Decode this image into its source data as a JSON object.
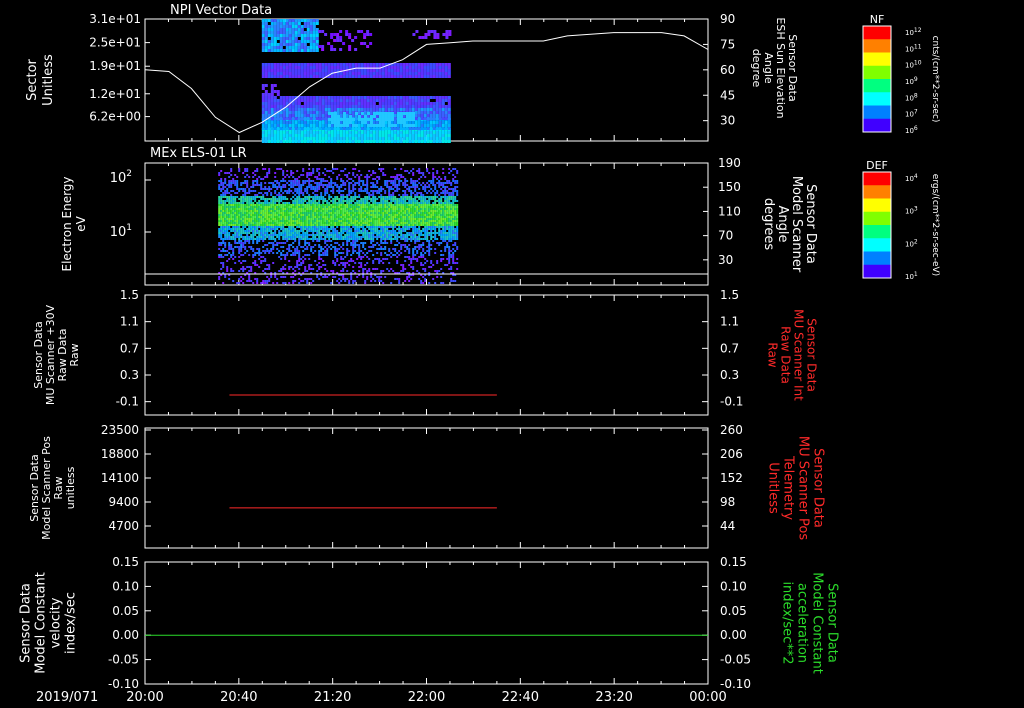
{
  "chart_data": [
    {
      "type": "heatmap",
      "title": "NPI Vector Data",
      "ylabel_left": "Sector\nUnitless",
      "yticks_left": [
        "3.1e+01",
        "2.5e+01",
        "1.9e+01",
        "1.2e+01",
        "6.2e+00"
      ],
      "yticks_left_values": [
        31,
        25,
        19,
        12,
        6.2
      ],
      "ylim_left": [
        0,
        31
      ],
      "ylabel_right": "Sensor Data\nESH Sun Elevation\nAngle\ndegree",
      "yticks_right": [
        "90",
        "75",
        "60",
        "45",
        "30"
      ],
      "ylim_right": [
        18,
        90
      ],
      "line_series": {
        "name": "ESH Sun Elevation Angle",
        "x_hours": [
          20.0,
          20.17,
          20.33,
          20.5,
          20.67,
          20.83,
          21.0,
          21.17,
          21.33,
          21.5,
          21.67,
          21.83,
          22.0,
          22.17,
          22.33,
          22.5,
          22.67,
          22.83,
          23.0,
          23.33,
          23.67,
          23.83,
          24.0
        ],
        "y_deg": [
          60,
          59,
          49,
          32,
          23,
          29,
          38,
          50,
          58,
          61,
          61,
          66,
          75,
          76,
          77,
          77,
          77,
          77,
          80,
          82,
          82,
          80,
          72
        ]
      },
      "colorbar": {
        "label": "NF",
        "units": "cnts/(cm**2-sr-sec)",
        "ticks": [
          "10^12",
          "10^11",
          "10^10",
          "10^9",
          "10^8",
          "10^7",
          "10^6"
        ]
      }
    },
    {
      "type": "heatmap",
      "title": "MEx ELS-01 LR",
      "ylabel_left": "Electron Energy\neV",
      "yticks_left": [
        "10^2",
        "10^1"
      ],
      "ylim_left": [
        1,
        160
      ],
      "ylabel_right": "Sensor Data\nModel Scanner\nAngle\ndegrees",
      "yticks_right": [
        "190",
        "150",
        "110",
        "70",
        "30"
      ],
      "ylim_right": [
        0,
        190
      ],
      "colorbar": {
        "label": "DEF",
        "units": "ergs/(cm**2-sr-sec-eV)",
        "ticks": [
          "10^4",
          "10^3",
          "10^2",
          "10^1"
        ]
      }
    },
    {
      "type": "line",
      "ylabel_left": "Sensor Data\nMU Scanner +30V\nRaw Data\nRaw",
      "yticks_left": [
        "1.5",
        "1.1",
        "0.7",
        "0.3",
        "-0.1"
      ],
      "ylim_left": [
        -0.3,
        1.5
      ],
      "ylabel_right": "Sensor Data\nMU Scanner Int\nRaw Data\nRaw",
      "yticks_right": [
        "1.5",
        "1.1",
        "0.7",
        "0.3",
        "-0.1"
      ],
      "series": [
        {
          "x_hours": [
            20.6,
            22.5
          ],
          "values": [
            0.0,
            0.0
          ],
          "color": "#ff2a2a"
        }
      ]
    },
    {
      "type": "line",
      "ylabel_left": "Sensor Data\nModel Scanner Pos\nRaw\nunitless",
      "yticks_left": [
        "23500",
        "18800",
        "14100",
        "9400",
        "4700"
      ],
      "ylim_left": [
        0,
        23500
      ],
      "ylabel_right": "Sensor Data\nMU Scanner Pos\nTelemetry\nUnitless",
      "yticks_right": [
        "260",
        "206",
        "152",
        "98",
        "44"
      ],
      "series": [
        {
          "x_hours": [
            20.6,
            22.5
          ],
          "values": [
            7850,
            7850
          ],
          "color": "#ff2a2a"
        }
      ]
    },
    {
      "type": "line",
      "ylabel_left": "Sensor Data\nModel Constant\nvelocity\nindex/sec",
      "yticks_left": [
        "0.15",
        "0.10",
        "0.05",
        "0.00",
        "-0.05",
        "-0.10"
      ],
      "ylim_left": [
        -0.1,
        0.15
      ],
      "ylabel_right": "Sensor Data\nModel Constant\nacceleration\nindex/sec**2",
      "yticks_right": [
        "0.15",
        "0.10",
        "0.05",
        "0.00",
        "-0.05",
        "-0.10"
      ],
      "series": [
        {
          "x_hours": [
            20.0,
            24.0
          ],
          "values": [
            0.0,
            0.0
          ],
          "color": "#2bdc2b"
        }
      ]
    }
  ],
  "x_axis": {
    "date_label": "2019/071",
    "ticks": [
      "20:00",
      "20:40",
      "21:20",
      "22:00",
      "22:40",
      "23:20",
      "00:00"
    ],
    "x_range_hours": [
      20.0,
      24.0
    ]
  }
}
